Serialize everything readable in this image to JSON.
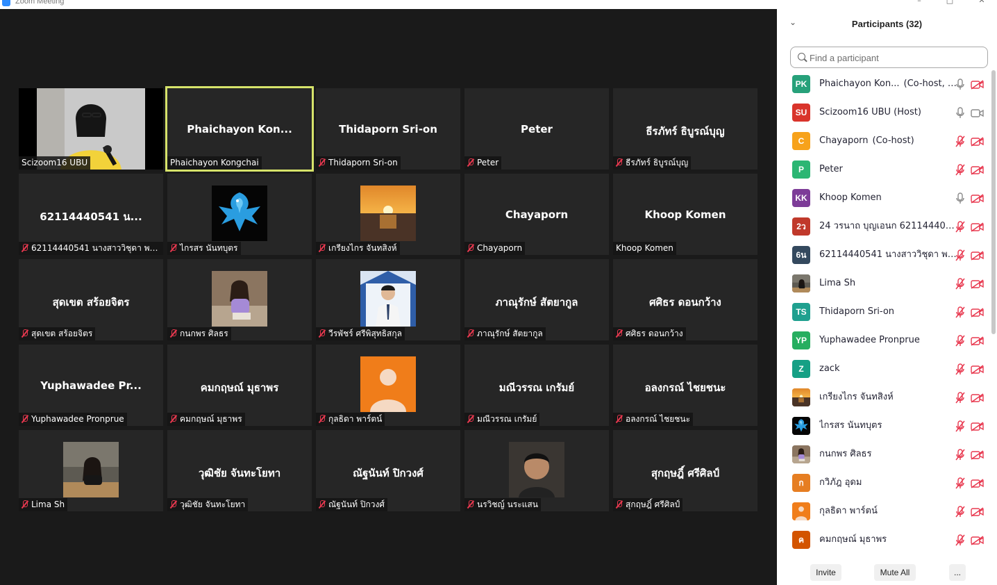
{
  "window": {
    "title": "Zoom Meeting"
  },
  "gallery": {
    "tiles": [
      {
        "big": "",
        "label": "Scizoom16 UBU",
        "muted": false,
        "video": "person-yellow"
      },
      {
        "big": "Phaichayon  Kon...",
        "label": "Phaichayon Kongchai",
        "muted": false,
        "video": ""
      },
      {
        "big": "Thidaporn Sri-on",
        "label": "Thidaporn Sri-on",
        "muted": true,
        "video": ""
      },
      {
        "big": "Peter",
        "label": "Peter",
        "muted": true,
        "video": ""
      },
      {
        "big": "ธีรภัทร์ ธิบูรณ์บุญ",
        "label": "ธีรภัทร์ ธิบูรณ์บุญ",
        "muted": true,
        "video": ""
      },
      {
        "big": "62114440541 น...",
        "label": "62114440541 นางสาววิชุดา พรม...",
        "muted": true,
        "video": ""
      },
      {
        "big": "",
        "label": "ไกรสร นันทบุตร",
        "muted": true,
        "video": "bird"
      },
      {
        "big": "",
        "label": "เกรียงไกร จันทสิงห์",
        "muted": true,
        "video": "sunset"
      },
      {
        "big": "Chayaporn",
        "label": "Chayaporn",
        "muted": true,
        "video": ""
      },
      {
        "big": "Khoop Komen",
        "label": "Khoop Komen",
        "muted": false,
        "video": ""
      },
      {
        "big": "สุดเขต สร้อยจิตร",
        "label": "สุดเขต สร้อยจิตร",
        "muted": true,
        "video": ""
      },
      {
        "big": "",
        "label": "กนกพร ศิลธร",
        "muted": true,
        "video": "girl"
      },
      {
        "big": "",
        "label": "วีรพัชร์ ศรีพิสุทธิสกุล",
        "muted": true,
        "video": "boy"
      },
      {
        "big": "ภาณุรักษ์ สัตยากูล",
        "label": "ภาณุรักษ์ สัตยากูล",
        "muted": true,
        "video": ""
      },
      {
        "big": "ศศิธร ดอนกว้าง",
        "label": "ศศิธร ดอนกว้าง",
        "muted": true,
        "video": ""
      },
      {
        "big": "Yuphawadee  Pr...",
        "label": "Yuphawadee Pronprue",
        "muted": true,
        "video": ""
      },
      {
        "big": "คมกฤษณ์ มุธาพร",
        "label": "คมกฤษณ์ มุธาพร",
        "muted": true,
        "video": ""
      },
      {
        "big": "",
        "label": "กุลธิดา พาร์ตน์",
        "muted": true,
        "video": "default-avatar"
      },
      {
        "big": "มณีวรรณ เกรัมย์",
        "label": "มณีวรรณ เกรัมย์",
        "muted": true,
        "video": ""
      },
      {
        "big": "อลงกรณ์ ไชยชนะ",
        "label": "อลงกรณ์ ไชยชนะ",
        "muted": true,
        "video": ""
      },
      {
        "big": "",
        "label": "Lima Sh",
        "muted": true,
        "video": "lima"
      },
      {
        "big": "วุฒิชัย จันทะโยทา",
        "label": "วุฒิชัย จันทะโยทา",
        "muted": true,
        "video": ""
      },
      {
        "big": "ณัฐนันท์ ปิกวงศ์",
        "label": "ณัฐนันท์ ปิกวงศ์",
        "muted": true,
        "video": ""
      },
      {
        "big": "",
        "label": "นรวิชญ์ นระแสน",
        "muted": true,
        "video": "man"
      },
      {
        "big": "สุกฤษฎิ์ ศรีศิลป์",
        "label": "สุกฤษฎิ์ ศรีศิลป์",
        "muted": true,
        "video": ""
      }
    ]
  },
  "panel": {
    "title": "Participants (32)",
    "search_placeholder": "Find a participant",
    "participants": [
      {
        "initials": "PK",
        "color": "#27a17a",
        "name": "Phaichayon Kon...",
        "role": "(Co-host, me)",
        "mic": "on",
        "cam": "off"
      },
      {
        "initials": "SU",
        "color": "#d9342b",
        "name": "Scizoom16 UBU (Host)",
        "role": "",
        "mic": "on",
        "cam": "on"
      },
      {
        "initials": "C",
        "color": "#f7a21b",
        "name": "Chayaporn",
        "role": "(Co-host)",
        "mic": "off",
        "cam": "off"
      },
      {
        "initials": "P",
        "color": "#2bb673",
        "name": "Peter",
        "role": "",
        "mic": "off",
        "cam": "off"
      },
      {
        "initials": "KK",
        "color": "#7d3c98",
        "name": "Khoop Komen",
        "role": "",
        "mic": "on",
        "cam": "off"
      },
      {
        "initials": "2ว",
        "color": "#c0392b",
        "name": "24 วรนาถ บุญเอนก 62114440288",
        "role": "",
        "mic": "off",
        "cam": "off"
      },
      {
        "initials": "6น",
        "color": "#34495e",
        "name": "62114440541 นางสาววิชุดา พรมโส...",
        "role": "",
        "mic": "off",
        "cam": "off"
      },
      {
        "initials": "",
        "color": "#7a6a5a",
        "name": "Lima Sh",
        "role": "",
        "mic": "off",
        "cam": "off",
        "photo": "lima"
      },
      {
        "initials": "TS",
        "color": "#1fa08f",
        "name": "Thidaporn Sri-on",
        "role": "",
        "mic": "off",
        "cam": "off"
      },
      {
        "initials": "YP",
        "color": "#27ae60",
        "name": "Yuphawadee Pronprue",
        "role": "",
        "mic": "off",
        "cam": "off"
      },
      {
        "initials": "Z",
        "color": "#16a085",
        "name": "zack",
        "role": "",
        "mic": "off",
        "cam": "off"
      },
      {
        "initials": "",
        "color": "#c97a28",
        "name": "เกรียงไกร จันทสิงห์",
        "role": "",
        "mic": "off",
        "cam": "off",
        "photo": "sunset"
      },
      {
        "initials": "",
        "color": "#111",
        "name": "ไกรสร นันทบุตร",
        "role": "",
        "mic": "off",
        "cam": "off",
        "photo": "bird"
      },
      {
        "initials": "",
        "color": "#9a8a7a",
        "name": "กนกพร ศิลธร",
        "role": "",
        "mic": "off",
        "cam": "off",
        "photo": "girl"
      },
      {
        "initials": "ก",
        "color": "#e67e22",
        "name": "กวิภัฎ อุดม",
        "role": "",
        "mic": "off",
        "cam": "off"
      },
      {
        "initials": "",
        "color": "#f07d1a",
        "name": "กุลธิดา พาร์ตน์",
        "role": "",
        "mic": "off",
        "cam": "off",
        "photo": "default-avatar"
      },
      {
        "initials": "ค",
        "color": "#d35400",
        "name": "คมกฤษณ์ มุธาพร",
        "role": "",
        "mic": "off",
        "cam": "off"
      }
    ],
    "footer": {
      "invite": "Invite",
      "mute_all": "Mute All",
      "more": "..."
    }
  }
}
